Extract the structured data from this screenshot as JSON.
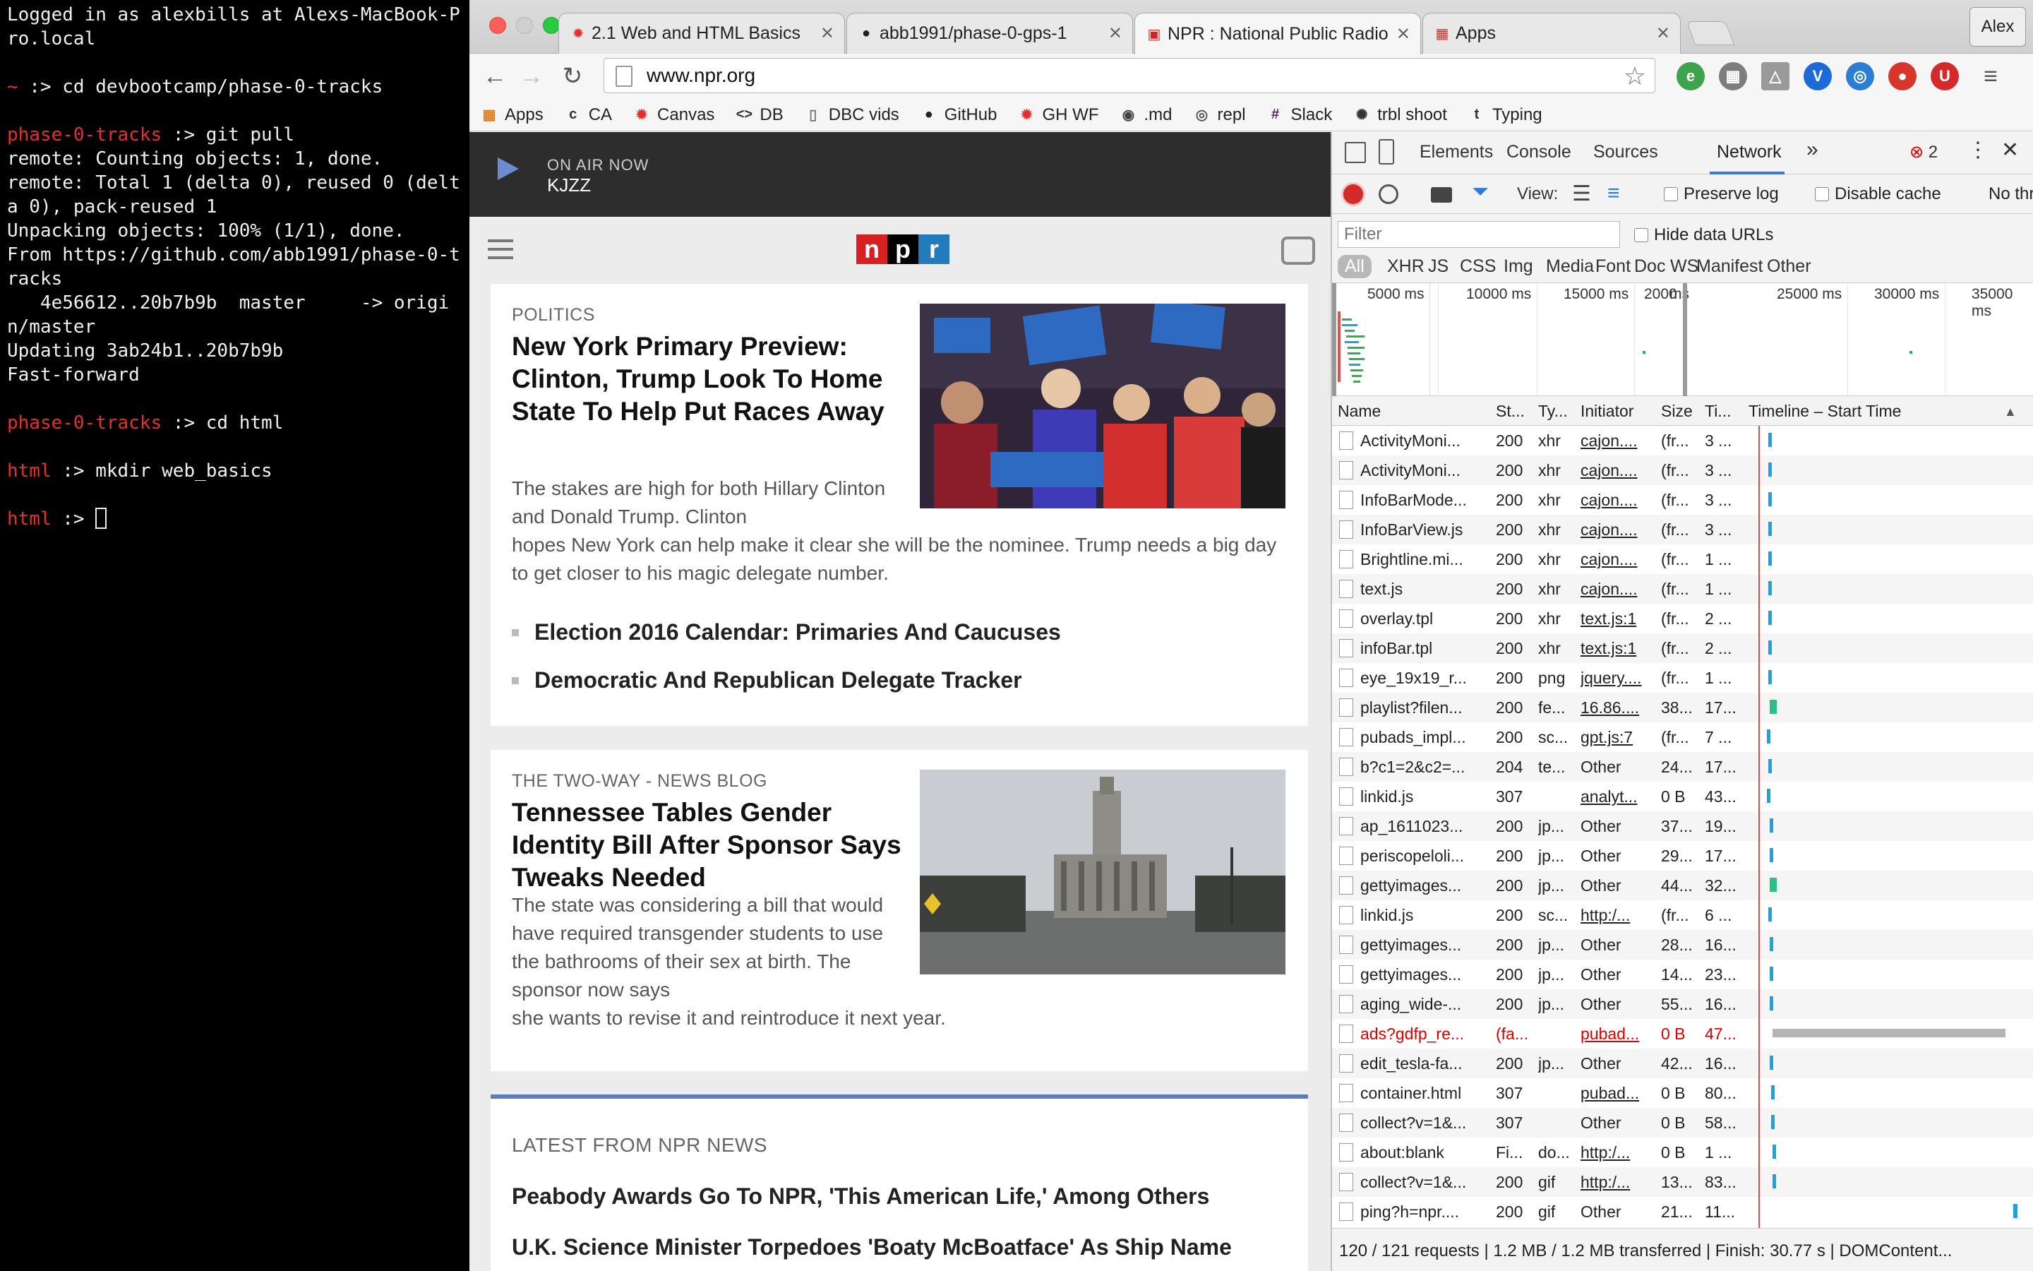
{
  "terminal": {
    "lines": [
      {
        "prompt": "",
        "text": "Logged in as alexbills at Alexs-MacBook-Pro.local"
      },
      {
        "prompt": "",
        "text": ""
      },
      {
        "prompt": "~",
        "text": " :> cd devbootcamp/phase-0-tracks"
      },
      {
        "prompt": "",
        "text": ""
      },
      {
        "prompt": "phase-0-tracks",
        "text": " :> git pull"
      },
      {
        "prompt": "",
        "text": "remote: Counting objects: 1, done."
      },
      {
        "prompt": "",
        "text": "remote: Total 1 (delta 0), reused 0 (delta 0), pack-reused 1"
      },
      {
        "prompt": "",
        "text": "Unpacking objects: 100% (1/1), done."
      },
      {
        "prompt": "",
        "text": "From https://github.com/abb1991/phase-0-tracks"
      },
      {
        "prompt": "",
        "text": "   4e56612..20b7b9b  master     -> origin/master"
      },
      {
        "prompt": "",
        "text": "Updating 3ab24b1..20b7b9b"
      },
      {
        "prompt": "",
        "text": "Fast-forward"
      },
      {
        "prompt": "",
        "text": ""
      },
      {
        "prompt": "phase-0-tracks",
        "text": " :> cd html"
      },
      {
        "prompt": "",
        "text": ""
      },
      {
        "prompt": "html",
        "text": " :> mkdir web_basics"
      },
      {
        "prompt": "",
        "text": ""
      },
      {
        "prompt": "html",
        "text": " :> "
      }
    ]
  },
  "browser": {
    "tabs": [
      {
        "title": "2.1 Web and HTML Basics",
        "icon": "canvas-icon",
        "color": "#e3302f"
      },
      {
        "title": "abb1991/phase-0-gps-1",
        "icon": "github-icon",
        "color": "#222222"
      },
      {
        "title": "NPR : National Public Radio",
        "icon": "npr-icon",
        "color": "#d62021"
      },
      {
        "title": "Apps",
        "icon": "apps-icon",
        "color": "#e3302f"
      }
    ],
    "profile": "Alex",
    "url": "www.npr.org",
    "bookmarks": [
      {
        "label": "Apps",
        "icon": "apps-icon",
        "symbol": "▦",
        "color": "#e08020"
      },
      {
        "label": "CA",
        "icon": "ca-icon",
        "symbol": "c",
        "color": "#333333"
      },
      {
        "label": "Canvas",
        "icon": "canvas-icon",
        "symbol": "✹",
        "color": "#e3302f"
      },
      {
        "label": "DB",
        "icon": "code-icon",
        "symbol": "<>",
        "color": "#333333"
      },
      {
        "label": "DBC vids",
        "icon": "page-icon",
        "symbol": "▯",
        "color": "#777777"
      },
      {
        "label": "GitHub",
        "icon": "github-icon",
        "symbol": "●",
        "color": "#222222"
      },
      {
        "label": "GH WF",
        "icon": "canvas-icon",
        "symbol": "✹",
        "color": "#e3302f"
      },
      {
        "label": ".md",
        "icon": "eye-icon",
        "symbol": "◉",
        "color": "#444444"
      },
      {
        "label": "repl",
        "icon": "repl-icon",
        "symbol": "◎",
        "color": "#555555"
      },
      {
        "label": "Slack",
        "icon": "slack-icon",
        "symbol": "#",
        "color": "#611f69"
      },
      {
        "label": "trbl shoot",
        "icon": "bug-icon",
        "symbol": "✺",
        "color": "#333333"
      },
      {
        "label": "Typing",
        "icon": "typing-icon",
        "symbol": "t",
        "color": "#333333"
      }
    ]
  },
  "npr": {
    "on_air_label": "ON AIR NOW",
    "station": "KJZZ",
    "logo": [
      "n",
      "p",
      "r"
    ],
    "logo_colors": [
      "#d62021",
      "#000000",
      "#237bbd"
    ],
    "story1": {
      "slug": "POLITICS",
      "headline": "New York Primary Preview: Clinton, Trump Look To Home State To Help Put Races Away",
      "teaser": "The stakes are high for both Hillary Clinton and Donald Trump. Clinton hopes New York can help make it clear she will be the nominee. Trump needs a big day to get closer to his magic delegate number.",
      "related": [
        "Election 2016 Calendar: Primaries And Caucuses",
        "Democratic And Republican Delegate Tracker"
      ]
    },
    "story2": {
      "slug": "THE TWO-WAY - NEWS BLOG",
      "headline": "Tennessee Tables Gender Identity Bill After Sponsor Says Tweaks Needed",
      "teaser": "The state was considering a bill that would have required transgender students to use the bathrooms of their sex at birth. The sponsor now says she wants to revise it and reintroduce it next year."
    },
    "latest": {
      "heading": "LATEST FROM NPR NEWS",
      "items": [
        "Peabody Awards Go To NPR, 'This American Life,' Among Others",
        "U.K. Science Minister Torpedoes 'Boaty McBoatface' As Ship Name"
      ]
    }
  },
  "devtools": {
    "tabs": [
      "Elements",
      "Console",
      "Sources",
      "Network"
    ],
    "active_tab": "Network",
    "error_count": "2",
    "view_label": "View:",
    "preserve_log": "Preserve log",
    "disable_cache": "Disable cache",
    "throttle": "No thro",
    "filter_placeholder": "Filter",
    "hide_data_urls": "Hide data URLs",
    "type_filters": [
      "All",
      "XHR",
      "JS",
      "CSS",
      "Img",
      "Media",
      "Font",
      "Doc",
      "WS",
      "Manifest",
      "Other"
    ],
    "overview_ticks": [
      "5000 ms",
      "10000 ms",
      "15000 ms",
      "2000",
      "ms",
      "25000 ms",
      "30000 ms",
      "35000 ms"
    ],
    "columns": [
      "Name",
      "St...",
      "Ty...",
      "Initiator",
      "Size",
      "Ti...",
      "Timeline – Start Time"
    ],
    "rows": [
      {
        "name": "ActivityMoni...",
        "status": "200",
        "type": "xhr",
        "initiator": "cajon....",
        "size": "(fr...",
        "time": "3 ...",
        "link": true
      },
      {
        "name": "ActivityMoni...",
        "status": "200",
        "type": "xhr",
        "initiator": "cajon....",
        "size": "(fr...",
        "time": "3 ...",
        "link": true
      },
      {
        "name": "InfoBarMode...",
        "status": "200",
        "type": "xhr",
        "initiator": "cajon....",
        "size": "(fr...",
        "time": "3 ...",
        "link": true
      },
      {
        "name": "InfoBarView.js",
        "status": "200",
        "type": "xhr",
        "initiator": "cajon....",
        "size": "(fr...",
        "time": "3 ...",
        "link": true
      },
      {
        "name": "Brightline.mi...",
        "status": "200",
        "type": "xhr",
        "initiator": "cajon....",
        "size": "(fr...",
        "time": "1 ...",
        "link": true
      },
      {
        "name": "text.js",
        "status": "200",
        "type": "xhr",
        "initiator": "cajon....",
        "size": "(fr...",
        "time": "1 ...",
        "link": true
      },
      {
        "name": "overlay.tpl",
        "status": "200",
        "type": "xhr",
        "initiator": "text.js:1",
        "size": "(fr...",
        "time": "2 ...",
        "link": true
      },
      {
        "name": "infoBar.tpl",
        "status": "200",
        "type": "xhr",
        "initiator": "text.js:1",
        "size": "(fr...",
        "time": "2 ...",
        "link": true
      },
      {
        "name": "eye_19x19_r...",
        "status": "200",
        "type": "png",
        "initiator": "jquery....",
        "size": "(fr...",
        "time": "1 ...",
        "link": true
      },
      {
        "name": "playlist?filen...",
        "status": "200",
        "type": "fe...",
        "initiator": "16.86....",
        "size": "38...",
        "time": "17...",
        "link": true
      },
      {
        "name": "pubads_impl...",
        "status": "200",
        "type": "sc...",
        "initiator": "gpt.js:7",
        "size": "(fr...",
        "time": "7 ...",
        "link": true
      },
      {
        "name": "b?c1=2&c2=...",
        "status": "204",
        "type": "te...",
        "initiator": "Other",
        "size": "24...",
        "time": "17...",
        "link": false
      },
      {
        "name": "linkid.js",
        "status": "307",
        "type": "",
        "initiator": "analyt...",
        "size": "0 B",
        "time": "43...",
        "link": true
      },
      {
        "name": "ap_1611023...",
        "status": "200",
        "type": "jp...",
        "initiator": "Other",
        "size": "37...",
        "time": "19...",
        "link": false
      },
      {
        "name": "periscopeloli...",
        "status": "200",
        "type": "jp...",
        "initiator": "Other",
        "size": "29...",
        "time": "17...",
        "link": false
      },
      {
        "name": "gettyimages...",
        "status": "200",
        "type": "jp...",
        "initiator": "Other",
        "size": "44...",
        "time": "32...",
        "link": false
      },
      {
        "name": "linkid.js",
        "status": "200",
        "type": "sc...",
        "initiator": "http:/...",
        "size": "(fr...",
        "time": "6 ...",
        "link": true
      },
      {
        "name": "gettyimages...",
        "status": "200",
        "type": "jp...",
        "initiator": "Other",
        "size": "28...",
        "time": "16...",
        "link": false
      },
      {
        "name": "gettyimages...",
        "status": "200",
        "type": "jp...",
        "initiator": "Other",
        "size": "14...",
        "time": "23...",
        "link": false
      },
      {
        "name": "aging_wide-...",
        "status": "200",
        "type": "jp...",
        "initiator": "Other",
        "size": "55...",
        "time": "16...",
        "link": false
      },
      {
        "name": "ads?gdfp_re...",
        "status": "(fa...",
        "type": "",
        "initiator": "pubad...",
        "size": "0 B",
        "time": "47...",
        "link": true,
        "error": true
      },
      {
        "name": "edit_tesla-fa...",
        "status": "200",
        "type": "jp...",
        "initiator": "Other",
        "size": "42...",
        "time": "16...",
        "link": false
      },
      {
        "name": "container.html",
        "status": "307",
        "type": "",
        "initiator": "pubad...",
        "size": "0 B",
        "time": "80...",
        "link": true
      },
      {
        "name": "collect?v=1&...",
        "status": "307",
        "type": "",
        "initiator": "Other",
        "size": "0 B",
        "time": "58...",
        "link": false
      },
      {
        "name": "about:blank",
        "status": "Fi...",
        "type": "do...",
        "initiator": "http:/...",
        "size": "0 B",
        "time": "1 ...",
        "link": true
      },
      {
        "name": "collect?v=1&...",
        "status": "200",
        "type": "gif",
        "initiator": "http:/...",
        "size": "13...",
        "time": "83...",
        "link": true
      },
      {
        "name": "ping?h=npr....",
        "status": "200",
        "type": "gif",
        "initiator": "Other",
        "size": "21...",
        "time": "11...",
        "link": false
      }
    ],
    "status_bar": "120 / 121 requests  |  1.2 MB / 1.2 MB transferred  |  Finish: 30.77 s  |  DOMContent..."
  }
}
